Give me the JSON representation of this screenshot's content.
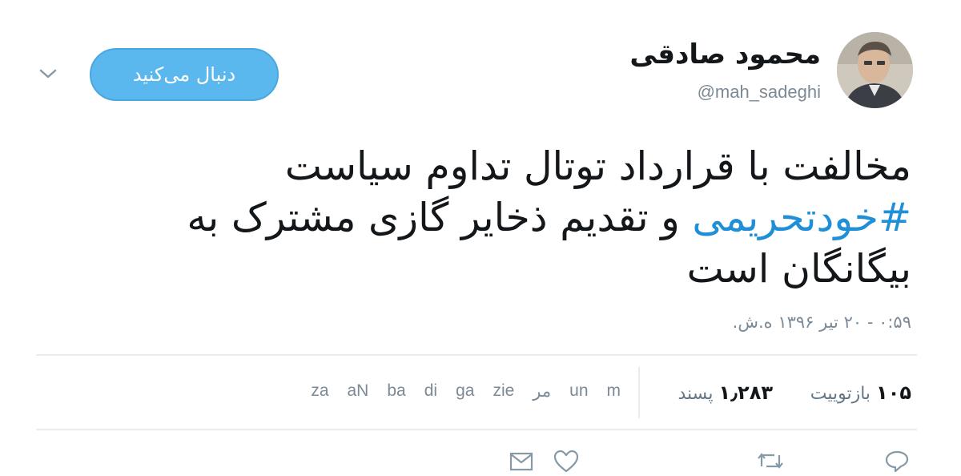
{
  "header": {
    "author_name": "محمود صادقی",
    "author_handle": "@mah_sadeghi",
    "follow_label": "دنبال می‌کنید",
    "avatar_icon": "user-avatar-photo",
    "more_icon": "chevron-down-icon"
  },
  "tweet": {
    "line1": "مخالفت با قرارداد توتال تداوم سیاست",
    "hashtag": "#خودتحریمی",
    "line2_rest": " و تقدیم ذخایر گازی مشترک به",
    "line3": "بیگانگان است",
    "timestamp": "۰:۵۹ - ۲۰ تیر ۱۳۹۶ ه.ش."
  },
  "stats": {
    "retweets_count": "۱۰۵",
    "retweets_label": "بازتوییت",
    "likes_count": "۱٫۲۸۳",
    "likes_label": "پسند",
    "likers": [
      "m",
      "un",
      "مر",
      "zie",
      "ga",
      "di",
      "ba",
      "aN",
      "za"
    ]
  },
  "actions": {
    "reply_icon": "reply-icon",
    "retweet_icon": "retweet-icon",
    "like_icon": "heart-icon",
    "message_icon": "mail-icon"
  },
  "colors": {
    "accent": "#1f8fd8",
    "follow_bg": "#5bb8ef",
    "muted": "#7b8a96",
    "divider": "#e6ecf0"
  }
}
